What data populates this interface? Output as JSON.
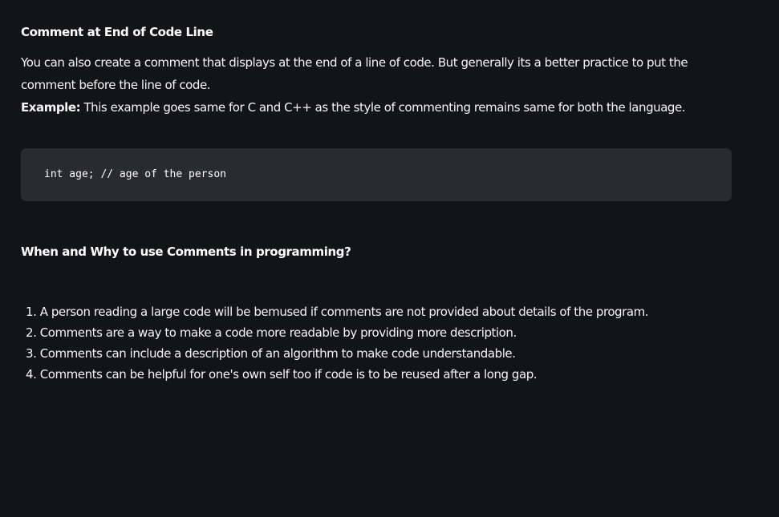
{
  "sections": {
    "end_of_line": {
      "heading": "Comment at End of Code Line",
      "intro": "You can also create a comment that displays at the end of a line of code. But generally its a better practice to put the comment before the line of code.",
      "example_label": "Example:",
      "example_text": " This example goes same for C and C++ as the style of commenting remains same for both the language.",
      "code": "int age; // age of the person"
    },
    "when_why": {
      "heading": "When and Why to use Comments in programming?",
      "items": [
        "1. A person reading a large code will be bemused if comments are not provided about details of the program.",
        "2. Comments are a way to make a code more readable by providing more description.",
        "3. Comments can include a description of an algorithm to make code understandable.",
        "4. Comments can be helpful for one's own self too if code is to be reused after a long gap."
      ]
    }
  },
  "colors": {
    "background": "#131417",
    "code_background": "#2a2b2f",
    "text": "#ffffff"
  }
}
